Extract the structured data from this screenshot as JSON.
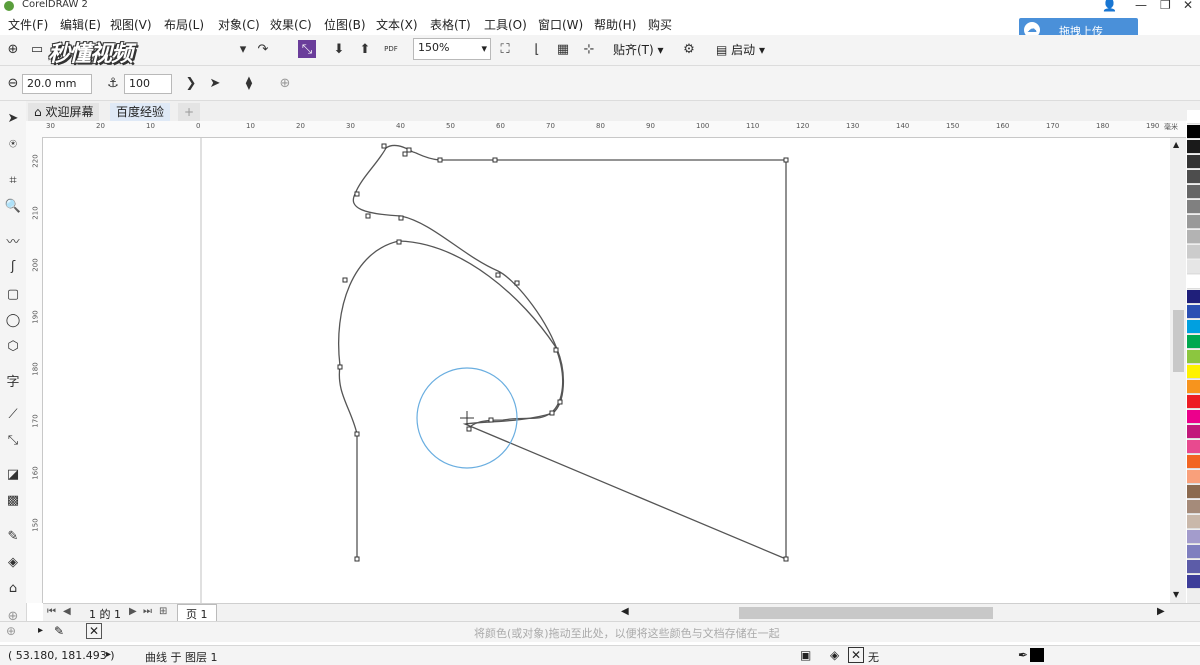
{
  "app": {
    "title": "CorelDRAW 2"
  },
  "menu": [
    "文件(F)",
    "编辑(E)",
    "视图(V)",
    "布局(L)",
    "对象(C)",
    "效果(C)",
    "位图(B)",
    "文本(X)",
    "表格(T)",
    "工具(O)",
    "窗口(W)",
    "帮助(H)",
    "购买"
  ],
  "upload": {
    "label": "拖拽上传"
  },
  "watermark": "秒懂视频",
  "toolbar": {
    "zoom": "150%",
    "snap_label": "贴齐(T)",
    "launch_label": "启动",
    "pdf_label": "PDF"
  },
  "propbar": {
    "outline_width": "20.0 mm",
    "value": "100"
  },
  "tabs": [
    {
      "label": "欢迎屏幕"
    },
    {
      "label": "百度经验"
    }
  ],
  "ruler": {
    "h_labels": [
      "30",
      "20",
      "10",
      "0",
      "10",
      "20",
      "30",
      "40",
      "50",
      "60",
      "70",
      "80",
      "90",
      "100",
      "110",
      "120",
      "130",
      "140",
      "150",
      "160",
      "170",
      "180",
      "190"
    ],
    "h_unit": "毫米",
    "v_labels": [
      "220",
      "210",
      "200",
      "190",
      "180",
      "170",
      "160",
      "150"
    ]
  },
  "pagenav": {
    "page_text": "1 的 1",
    "page_tab": "页 1"
  },
  "hint": {
    "text": "将颜色(或对象)拖动至此处，以便将这些颜色与文档存储在一起"
  },
  "status": {
    "coords": "( 53.180, 181.493 )",
    "layer": "曲线 于 图层 1",
    "fill": "无"
  },
  "colors": {
    "accent": "#4a90d9",
    "circle": "#6aaee0"
  },
  "palette": [
    "#ffffff",
    "#000000",
    "#1a1a1a",
    "#333333",
    "#4d4d4d",
    "#666666",
    "#808080",
    "#999999",
    "#b3b3b3",
    "#cccccc",
    "#e6e6e6",
    "#ffffff",
    "#1f1f7a",
    "#2a4fb3",
    "#00a0e0",
    "#00a84f",
    "#8cc63f",
    "#fff200",
    "#f7941d",
    "#ed1c24",
    "#ec008c",
    "#c2187b",
    "#e84a8f",
    "#f26522",
    "#f9a07b",
    "#8b6a4f",
    "#a58b7a",
    "#c9b8aa",
    "#a39ccc",
    "#7f7fbf",
    "#5c5ca8",
    "#3d3d99"
  ]
}
